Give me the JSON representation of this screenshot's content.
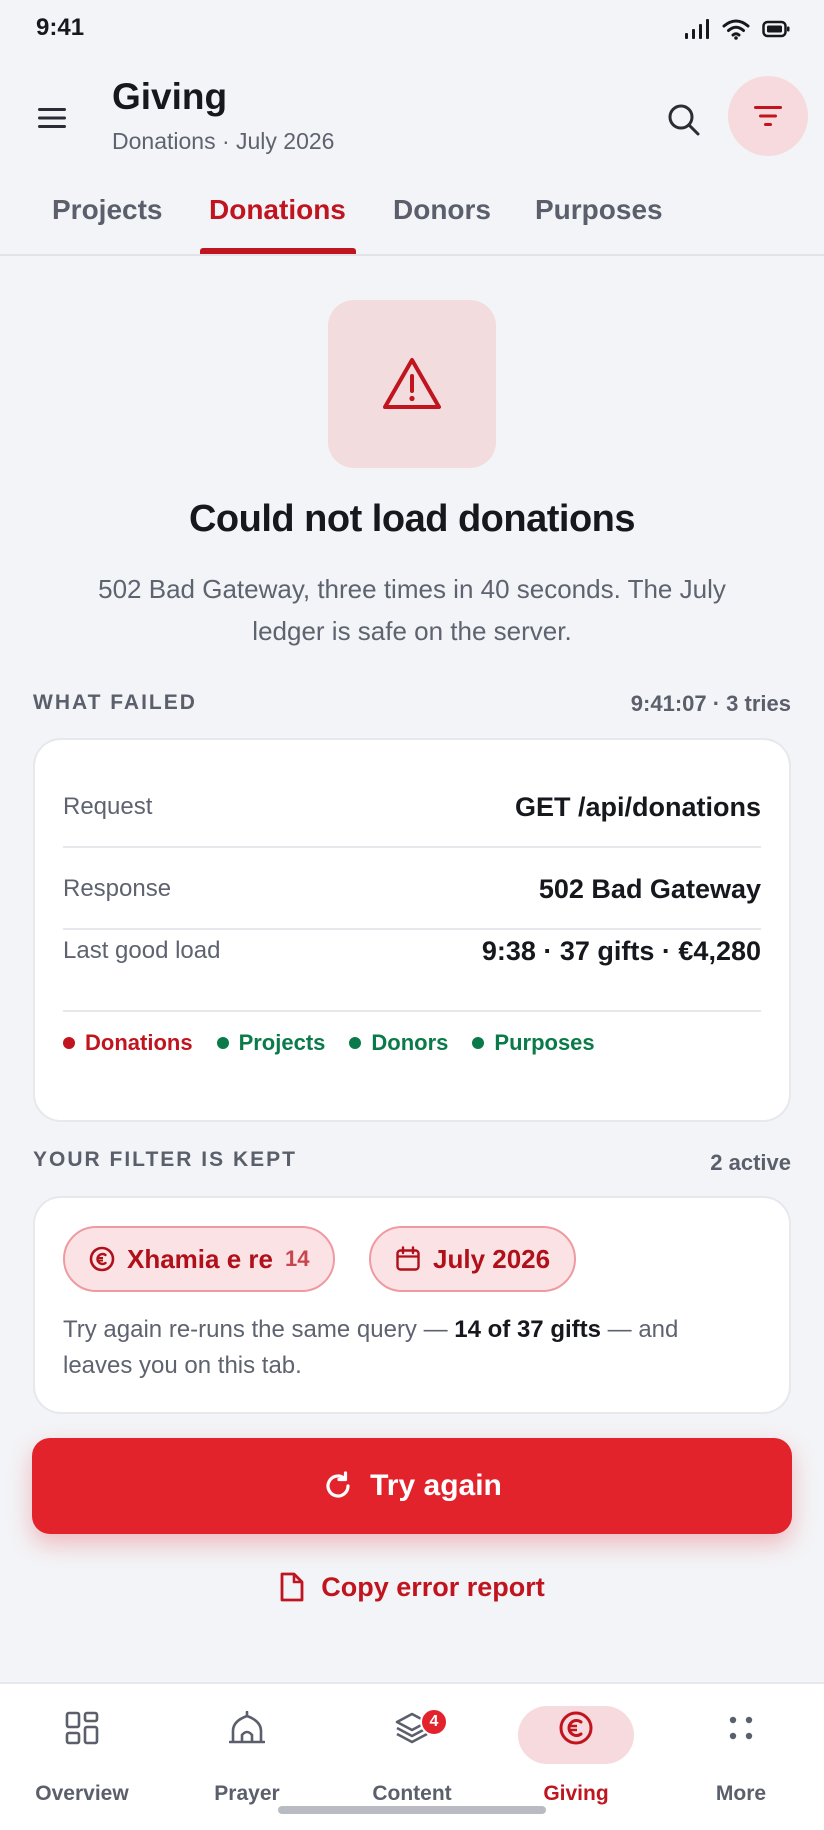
{
  "status_bar": {
    "time": "9:41"
  },
  "header": {
    "title": "Giving",
    "subtitle": "Donations · July 2026"
  },
  "tabs": [
    {
      "label": "Projects",
      "active": false
    },
    {
      "label": "Donations",
      "active": true
    },
    {
      "label": "Donors",
      "active": false
    },
    {
      "label": "Purposes",
      "active": false
    }
  ],
  "error": {
    "icon": "warning-triangle-icon",
    "title": "Could not load donations",
    "description": "502 Bad Gateway, three times in 40 seconds. The July ledger is safe on the server."
  },
  "what_failed": {
    "label": "WHAT FAILED",
    "meta": "9:41:07 · 3 tries",
    "rows": [
      {
        "key": "Request",
        "value": "GET /api/donations"
      },
      {
        "key": "Response",
        "value": "502 Bad Gateway"
      },
      {
        "key": "Last good load",
        "value": "9:38 · 37 gifts · €4,280"
      }
    ],
    "services": [
      {
        "name": "Donations",
        "status": "failed",
        "color": "#c0141e"
      },
      {
        "name": "Projects",
        "status": "ok",
        "color": "#0b7a4a"
      },
      {
        "name": "Donors",
        "status": "ok",
        "color": "#0b7a4a"
      },
      {
        "name": "Purposes",
        "status": "ok",
        "color": "#0b7a4a"
      }
    ]
  },
  "filter": {
    "label": "YOUR FILTER IS KEPT",
    "meta": "2 active",
    "chips": [
      {
        "icon": "euro-icon",
        "label": "Xhamia e re",
        "count": "14"
      },
      {
        "icon": "calendar-icon",
        "label": "July 2026"
      }
    ],
    "note_prefix": "Try again re-runs the same query — ",
    "note_bold": "14 of 37 gifts",
    "note_suffix": " — and leaves you on this tab."
  },
  "actions": {
    "try_again": "Try again",
    "copy_report": "Copy error report"
  },
  "bottom_nav": [
    {
      "label": "Overview",
      "icon": "grid-icon",
      "active": false
    },
    {
      "label": "Prayer",
      "icon": "mosque-icon",
      "active": false
    },
    {
      "label": "Content",
      "icon": "layers-icon",
      "active": false,
      "badge": "4"
    },
    {
      "label": "Giving",
      "icon": "euro-coin-icon",
      "active": true
    },
    {
      "label": "More",
      "icon": "dots-icon",
      "active": false
    }
  ],
  "colors": {
    "accent": "#c0141e",
    "primary_button": "#e3232c",
    "ok": "#0b7a4a",
    "accent_soft": "#f7dadd"
  }
}
